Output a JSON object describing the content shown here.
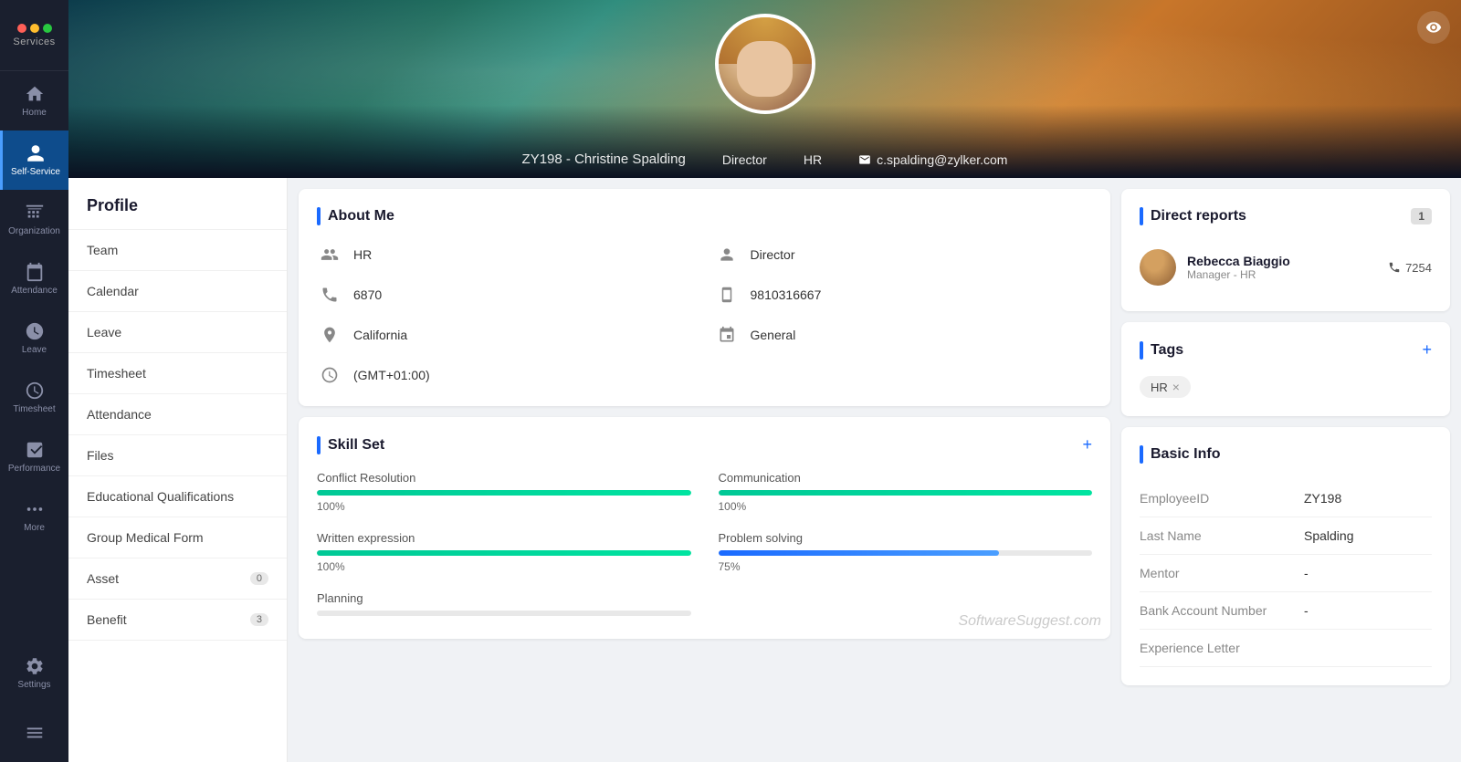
{
  "sidebar": {
    "logo_label": "Services",
    "items": [
      {
        "id": "home",
        "label": "Home",
        "icon": "home"
      },
      {
        "id": "self-service",
        "label": "Self-Service",
        "icon": "person",
        "active": true
      },
      {
        "id": "organization",
        "label": "Organization",
        "icon": "org"
      },
      {
        "id": "attendance",
        "label": "Attendance",
        "icon": "calendar"
      },
      {
        "id": "leave",
        "label": "Leave",
        "icon": "leave"
      },
      {
        "id": "timesheet",
        "label": "Timesheet",
        "icon": "clock"
      },
      {
        "id": "performance",
        "label": "Performance",
        "icon": "performance"
      },
      {
        "id": "more",
        "label": "More",
        "icon": "dots"
      }
    ],
    "settings_label": "Settings",
    "menu_icon": "menu"
  },
  "header": {
    "employee_id": "ZY198",
    "name": "Christine Spalding",
    "title": "Director",
    "department": "HR",
    "email": "c.spalding@zylker.com"
  },
  "left_nav": {
    "title": "Profile",
    "items": [
      {
        "label": "Team",
        "badge": null
      },
      {
        "label": "Calendar",
        "badge": null
      },
      {
        "label": "Leave",
        "badge": null
      },
      {
        "label": "Timesheet",
        "badge": null
      },
      {
        "label": "Attendance",
        "badge": null
      },
      {
        "label": "Files",
        "badge": null
      },
      {
        "label": "Educational Qualifications",
        "badge": null
      },
      {
        "label": "Group Medical Form",
        "badge": null
      },
      {
        "label": "Asset",
        "badge": "0"
      },
      {
        "label": "Benefit",
        "badge": "3"
      }
    ]
  },
  "about_me": {
    "title": "About Me",
    "fields": [
      {
        "icon": "org-icon",
        "value": "HR",
        "col": 1
      },
      {
        "icon": "person-title-icon",
        "value": "Director",
        "col": 2
      },
      {
        "icon": "phone-icon",
        "value": "6870",
        "col": 1
      },
      {
        "icon": "mobile-icon",
        "value": "9810316667",
        "col": 2
      },
      {
        "icon": "location-icon",
        "value": "California",
        "col": 1
      },
      {
        "icon": "calendar-icon",
        "value": "General",
        "col": 2
      },
      {
        "icon": "clock-icon",
        "value": "(GMT+01:00)",
        "col": 1
      }
    ]
  },
  "skill_set": {
    "title": "Skill Set",
    "add_label": "+",
    "skills": [
      {
        "name": "Conflict Resolution",
        "percent": 100,
        "type": "green"
      },
      {
        "name": "Communication",
        "percent": 100,
        "type": "green"
      },
      {
        "name": "Written expression",
        "percent": 100,
        "type": "green"
      },
      {
        "name": "Problem solving",
        "percent": 75,
        "type": "blue"
      },
      {
        "name": "Planning",
        "percent": 0,
        "type": "green"
      }
    ]
  },
  "direct_reports": {
    "title": "Direct reports",
    "count": "1",
    "reports": [
      {
        "name": "Rebecca Biaggio",
        "role": "Manager - HR",
        "phone": "7254"
      }
    ]
  },
  "tags": {
    "title": "Tags",
    "add_label": "+",
    "items": [
      "HR"
    ]
  },
  "basic_info": {
    "title": "Basic Info",
    "fields": [
      {
        "label": "EmployeeID",
        "value": "ZY198"
      },
      {
        "label": "Last Name",
        "value": "Spalding"
      },
      {
        "label": "Mentor",
        "value": "-"
      },
      {
        "label": "Bank Account Number",
        "value": "-"
      },
      {
        "label": "Experience Letter",
        "value": ""
      }
    ]
  },
  "watermark": "SoftwareSuggest.com"
}
